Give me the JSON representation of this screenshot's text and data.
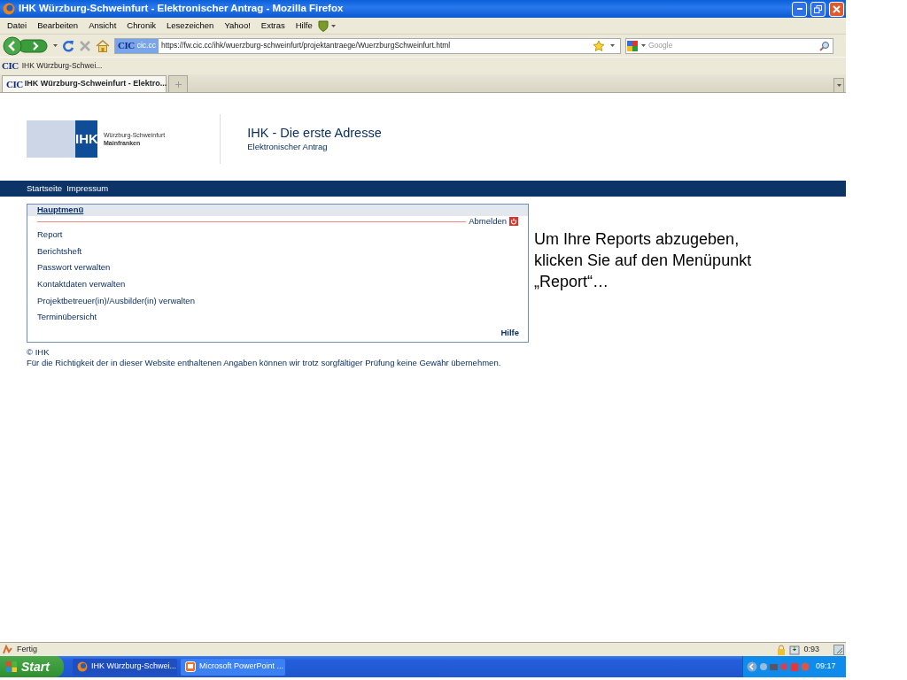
{
  "window": {
    "title": "IHK Würzburg-Schweinfurt - Elektronischer Antrag - Mozilla Firefox"
  },
  "menu_bar": [
    "Datei",
    "Bearbeiten",
    "Ansicht",
    "Chronik",
    "Lesezeichen",
    "Yahoo!",
    "Extras",
    "Hilfe"
  ],
  "nav_toolbar": {
    "site_badge_logo": "CIC",
    "site_badge_domain": "cic.cc",
    "url": "https://fw.cic.cc/ihk/wuerzburg-schweinfurt/projektantraege/WuerzburgSchweinfurt.html",
    "search_placeholder": "Google"
  },
  "bookmarks": [
    {
      "logo": "CIC",
      "label": "IHK Würzburg-Schwei..."
    }
  ],
  "tabs": [
    {
      "logo": "CIC",
      "label": "IHK Würzburg-Schweinfurt - Elektro...",
      "selected": true
    }
  ],
  "page": {
    "logo": {
      "mark": "IHK",
      "line1": "Würzburg-Schweinfurt",
      "line2": "Mainfranken"
    },
    "heading": "IHK - Die erste Adresse",
    "subheading": "Elektronischer Antrag",
    "nav": [
      "Startseite",
      "Impressum"
    ],
    "menu": {
      "title": "Hauptmenü",
      "logout": "Abmelden",
      "items": [
        "Report",
        "Berichtsheft",
        "Passwort verwalten",
        "Kontaktdaten verwalten",
        "Projektbetreuer(in)/Ausbilder(in) verwalten",
        "Terminübersicht"
      ],
      "help": "Hilfe"
    },
    "footer": {
      "copyright": "© IHK",
      "disclaimer": "Für die Richtigkeit der in dieser Website enthaltenen Angaben können wir trotz sorgfältiger Prüfung keine Gewähr übernehmen."
    }
  },
  "annotation": "Um Ihre Reports abzugeben, klicken Sie auf den Menüpunkt „Report“…",
  "status_bar": {
    "text": "Fertig",
    "counter": "0:93"
  },
  "taskbar": {
    "start": "Start",
    "tasks": [
      {
        "label": "IHK Würzburg-Schwei...",
        "selected": true
      },
      {
        "label": "Microsoft PowerPoint ...",
        "selected": false
      }
    ],
    "clock": "09:17"
  }
}
